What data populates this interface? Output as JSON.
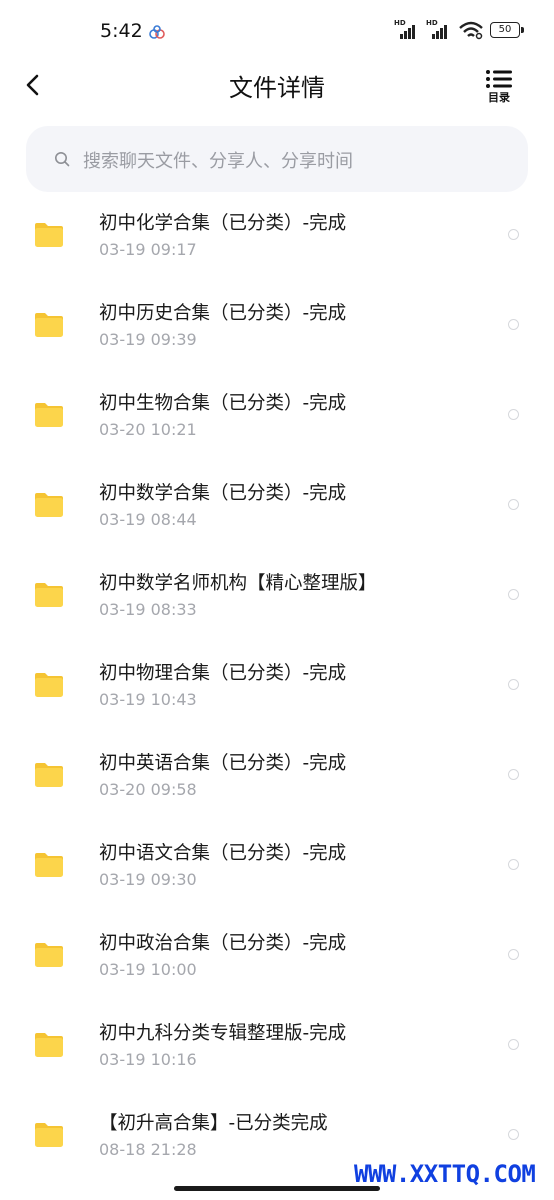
{
  "status_bar": {
    "time": "5:42",
    "signal_label": "HD",
    "battery": "50"
  },
  "nav": {
    "title": "文件详情",
    "toc_label": "目录"
  },
  "search": {
    "placeholder": "搜索聊天文件、分享人、分享时间"
  },
  "files": [
    {
      "name": "初中化学合集（已分类）-完成",
      "date": "03-19  09:17"
    },
    {
      "name": "初中历史合集（已分类）-完成",
      "date": "03-19  09:39"
    },
    {
      "name": "初中生物合集（已分类）-完成",
      "date": "03-20  10:21"
    },
    {
      "name": "初中数学合集（已分类）-完成",
      "date": "03-19  08:44"
    },
    {
      "name": "初中数学名师机构【精心整理版】",
      "date": "03-19  08:33"
    },
    {
      "name": "初中物理合集（已分类）-完成",
      "date": "03-19  10:43"
    },
    {
      "name": "初中英语合集（已分类）-完成",
      "date": "03-20  09:58"
    },
    {
      "name": "初中语文合集（已分类）-完成",
      "date": "03-19  09:30"
    },
    {
      "name": "初中政治合集（已分类）-完成",
      "date": "03-19  10:00"
    },
    {
      "name": "初中九科分类专辑整理版-完成",
      "date": "03-19  10:16"
    },
    {
      "name": "【初升高合集】-已分类完成",
      "date": "08-18  21:28"
    }
  ],
  "watermark": "WWW.XXTTQ.COM",
  "colors": {
    "folder": "#fcd54b",
    "folder_tab": "#f5c433",
    "search_bg": "#f4f5f9",
    "watermark": "#1040e0"
  }
}
